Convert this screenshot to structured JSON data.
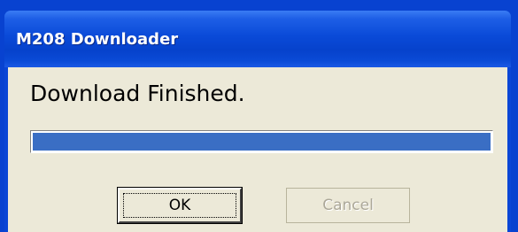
{
  "window": {
    "title": "M208 Downloader"
  },
  "dialog": {
    "message": "Download Finished.",
    "progress_percent": 100,
    "ok_label": "OK",
    "cancel_label": "Cancel"
  },
  "colors": {
    "titlebar": "#0a4ad8",
    "progress_fill": "#3a6ec4",
    "dialog_background": "#ece9d8",
    "disabled_text": "#aca899"
  }
}
